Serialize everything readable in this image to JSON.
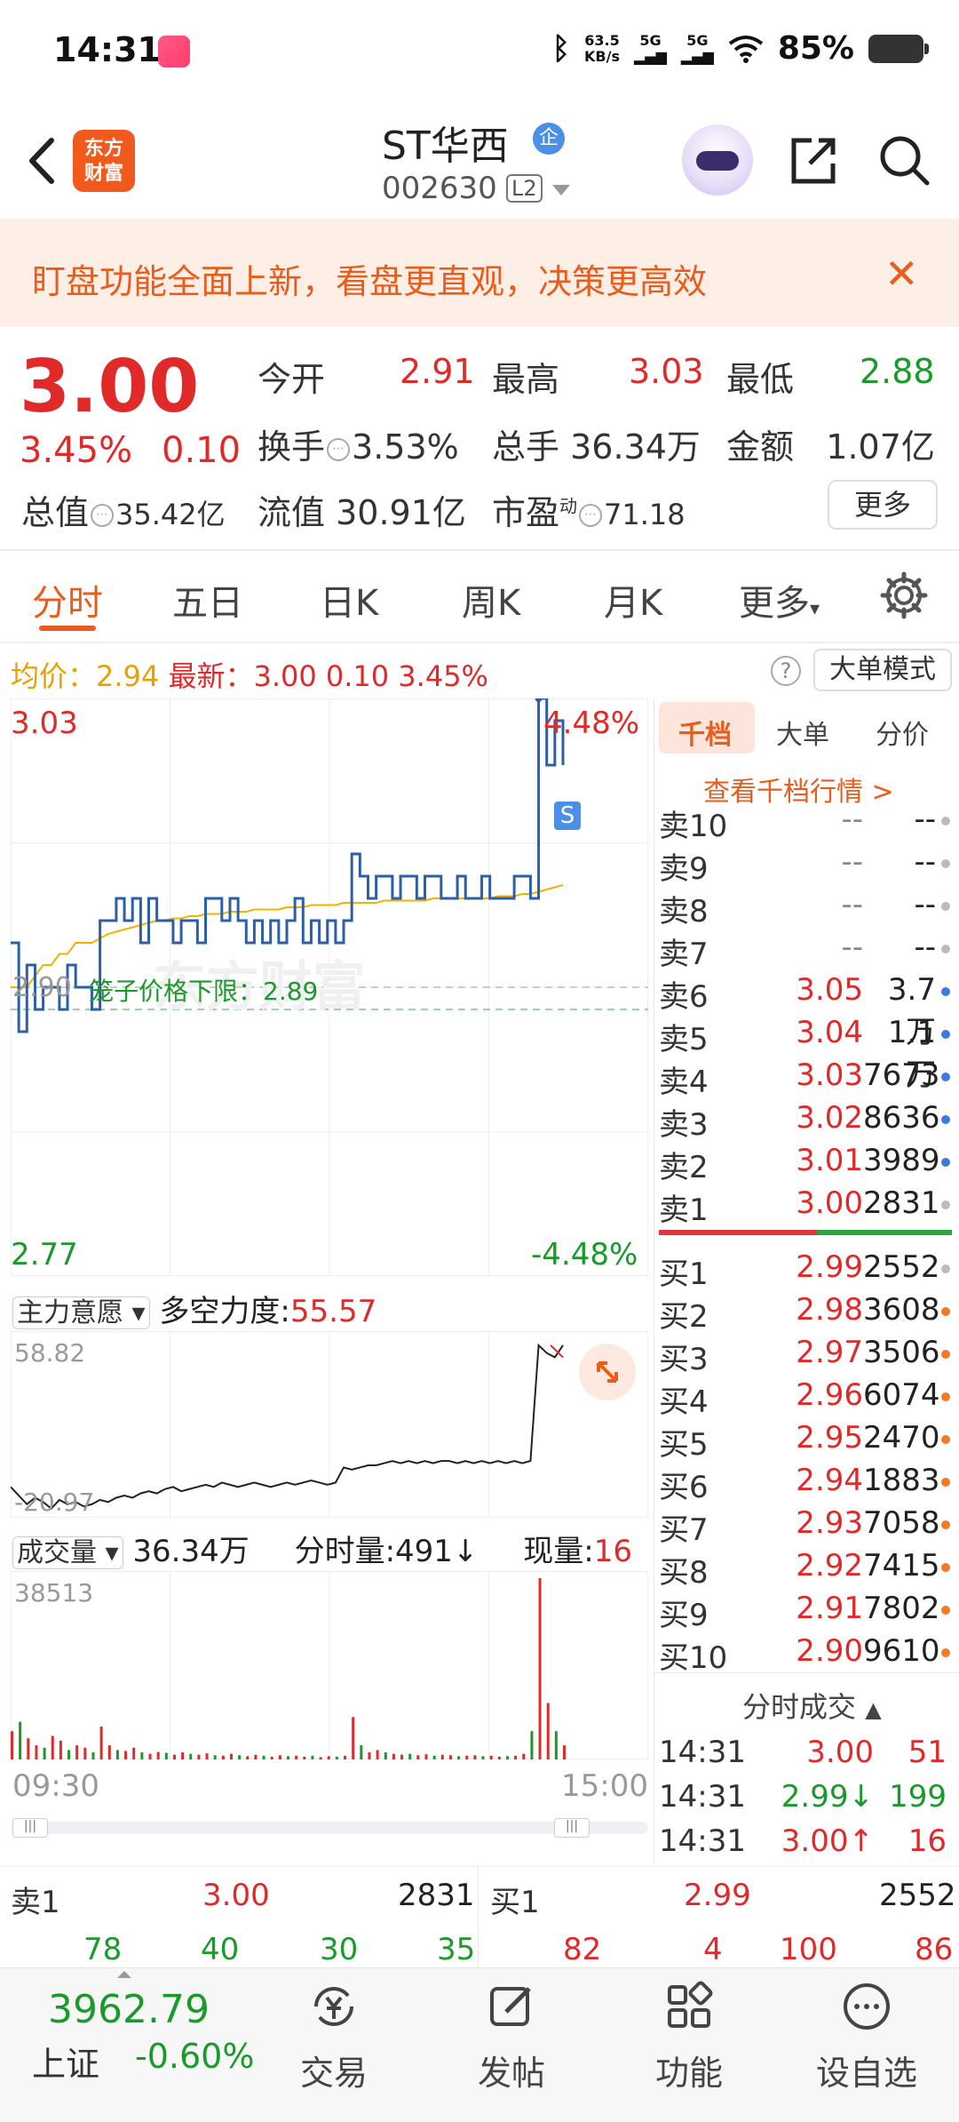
{
  "status_bar": {
    "time": "14:31",
    "net_speed_top": "63.5",
    "net_speed_bottom": "KB/s",
    "sig1": "5G",
    "sig2": "5G",
    "battery": "85%"
  },
  "header": {
    "stock_name": "ST华西",
    "badge": "企",
    "stock_code": "002630",
    "level": "L2",
    "logo_line1": "东方",
    "logo_line2": "财富"
  },
  "banner": {
    "text": "盯盘功能全面上新，看盘更直观，决策更高效",
    "close": "✕"
  },
  "quote": {
    "price": "3.00",
    "change_pct": "3.45%",
    "change": "0.10",
    "open_label": "今开",
    "open": "2.91",
    "high_label": "最高",
    "high": "3.03",
    "low_label": "最低",
    "low": "2.88",
    "turnover_label": "换手",
    "turnover": "3.53%",
    "volume_label": "总手",
    "volume": "36.34万",
    "amount_label": "金额",
    "amount": "1.07亿",
    "mcap_label": "总值",
    "mcap": "35.42亿",
    "float_label": "流值",
    "float": "30.91亿",
    "pe_label": "市盈",
    "pe_sup": "动",
    "pe": "71.18",
    "more": "更多"
  },
  "tabs": [
    "分时",
    "五日",
    "日K",
    "周K",
    "月K",
    "更多"
  ],
  "summary": {
    "avg_label": "均价：",
    "avg": "2.94",
    "last_label": "最新：",
    "last": "3.00",
    "chg": "0.10",
    "pct": "3.45%",
    "big_order_mode": "大单模式",
    "help": "?"
  },
  "chart": {
    "y_top": "3.03",
    "y_top_pct": "4.48%",
    "y_bottom": "2.77",
    "y_bottom_pct": "-4.48%",
    "y_mid": "2.90",
    "cage_label": "笼子价格下限：2.89",
    "s_marker": "S",
    "watermark": "东方财富",
    "ind_name": "主力意愿",
    "ind_label": "多空力度:",
    "ind_value": "55.57",
    "ind_max": "58.82",
    "ind_min": "-20.97",
    "vol_name": "成交量",
    "vol_total": "36.34万",
    "vol_min_label": "分时量:",
    "vol_min": "491",
    "vol_min_dir": "↓",
    "vol_now_label": "现量:",
    "vol_now": "16",
    "vol_max": "38513",
    "t_start": "09:30",
    "t_end": "15:00"
  },
  "chart_data": {
    "type": "line",
    "ylim": [
      2.77,
      3.03
    ],
    "price_line": [
      2.92,
      2.88,
      2.91,
      2.89,
      2.9,
      2.9,
      2.89,
      2.91,
      2.9,
      2.9,
      2.89,
      2.93,
      2.93,
      2.94,
      2.93,
      2.94,
      2.92,
      2.94,
      2.93,
      2.93,
      2.92,
      2.93,
      2.93,
      2.92,
      2.94,
      2.94,
      2.93,
      2.94,
      2.93,
      2.92,
      2.93,
      2.92,
      2.93,
      2.92,
      2.93,
      2.94,
      2.92,
      2.93,
      2.92,
      2.93,
      2.92,
      2.93,
      2.96,
      2.95,
      2.94,
      2.95,
      2.95,
      2.94,
      2.95,
      2.95,
      2.94,
      2.95,
      2.95,
      2.94,
      2.94,
      2.95,
      2.94,
      2.94,
      2.95,
      2.94,
      2.94,
      2.94,
      2.95,
      2.95,
      2.94,
      3.03,
      3.0,
      3.02,
      3.0
    ],
    "avg_line": [
      2.9,
      2.9,
      2.9,
      2.905,
      2.91,
      2.91,
      2.915,
      2.915,
      2.92,
      2.92,
      2.92,
      2.922,
      2.924,
      2.925,
      2.926,
      2.927,
      2.928,
      2.929,
      2.93,
      2.93,
      2.931,
      2.931,
      2.932,
      2.932,
      2.933,
      2.933,
      2.933,
      2.934,
      2.934,
      2.934,
      2.935,
      2.935,
      2.935,
      2.935,
      2.936,
      2.936,
      2.936,
      2.937,
      2.937,
      2.937,
      2.937,
      2.938,
      2.938,
      2.938,
      2.938,
      2.938,
      2.939,
      2.939,
      2.939,
      2.939,
      2.939,
      2.939,
      2.94,
      2.94,
      2.94,
      2.94,
      2.94,
      2.94,
      2.94,
      2.94,
      2.941,
      2.941,
      2.941,
      2.942,
      2.942,
      2.943,
      2.944,
      2.945,
      2.946
    ]
  },
  "indicator_data": {
    "ylim": [
      -20.97,
      58.82
    ],
    "values": [
      -10,
      -14,
      -18,
      -15,
      -17,
      -20,
      -16,
      -18,
      -17,
      -19,
      -18,
      -16,
      -17,
      -15,
      -14,
      -15,
      -13,
      -12,
      -13,
      -11,
      -10,
      -12,
      -11,
      -10,
      -9,
      -10,
      -8,
      -9,
      -10,
      -9,
      -8,
      -9,
      -10,
      -9,
      -8,
      -9,
      -8,
      -7,
      -8,
      -9,
      -8,
      -1,
      -2,
      -1,
      0,
      0,
      1,
      2,
      1,
      2,
      1,
      2,
      1,
      2,
      2,
      1,
      2,
      1,
      2,
      1,
      2,
      1,
      2,
      1,
      2,
      55.57,
      52,
      50,
      55.57
    ]
  },
  "volume_data": {
    "max": 38513,
    "bars": [
      6000,
      8000,
      4500,
      3000,
      2500,
      5000,
      4000,
      2000,
      3000,
      2500,
      1500,
      7000,
      3000,
      2000,
      1800,
      2500,
      1500,
      1200,
      1600,
      1400,
      1000,
      1500,
      1200,
      1000,
      1300,
      900,
      800,
      1200,
      900,
      700,
      1000,
      800,
      600,
      900,
      700,
      800,
      600,
      800,
      500,
      700,
      600,
      800,
      9000,
      3000,
      1500,
      2000,
      1500,
      1200,
      1000,
      1200,
      900,
      1100,
      800,
      1000,
      900,
      700,
      800,
      900,
      700,
      800,
      600,
      700,
      800,
      1200,
      6000,
      38513,
      12000,
      6000,
      3000
    ]
  },
  "order_book": {
    "tabs": [
      "千档",
      "大单",
      "分价"
    ],
    "link": "查看千档行情 >",
    "sells": [
      {
        "k": "卖10",
        "p": "--",
        "v": "--",
        "dot": "#bbbbbb"
      },
      {
        "k": "卖9",
        "p": "--",
        "v": "--",
        "dot": "#bbbbbb"
      },
      {
        "k": "卖8",
        "p": "--",
        "v": "--",
        "dot": "#bbbbbb"
      },
      {
        "k": "卖7",
        "p": "--",
        "v": "--",
        "dot": "#bbbbbb"
      },
      {
        "k": "卖6",
        "p": "3.05",
        "v": "3.7万",
        "dot": "#3b7bdc"
      },
      {
        "k": "卖5",
        "p": "3.04",
        "v": "1.1万",
        "dot": "#3b7bdc"
      },
      {
        "k": "卖4",
        "p": "3.03",
        "v": "7673",
        "dot": "#3b7bdc"
      },
      {
        "k": "卖3",
        "p": "3.02",
        "v": "8636",
        "dot": "#3b7bdc"
      },
      {
        "k": "卖2",
        "p": "3.01",
        "v": "3989",
        "dot": "#3b7bdc"
      },
      {
        "k": "卖1",
        "p": "3.00",
        "v": "2831",
        "dot": "#bbbbbb"
      }
    ],
    "buys": [
      {
        "k": "买1",
        "p": "2.99",
        "v": "2552",
        "dot": "#bbbbbb"
      },
      {
        "k": "买2",
        "p": "2.98",
        "v": "3608",
        "dot": "#f07a2a"
      },
      {
        "k": "买3",
        "p": "2.97",
        "v": "3506",
        "dot": "#f07a2a"
      },
      {
        "k": "买4",
        "p": "2.96",
        "v": "6074",
        "dot": "#f07a2a"
      },
      {
        "k": "买5",
        "p": "2.95",
        "v": "2470",
        "dot": "#f07a2a"
      },
      {
        "k": "买6",
        "p": "2.94",
        "v": "1883",
        "dot": "#f07a2a"
      },
      {
        "k": "买7",
        "p": "2.93",
        "v": "7058",
        "dot": "#f07a2a"
      },
      {
        "k": "买8",
        "p": "2.92",
        "v": "7415",
        "dot": "#f07a2a"
      },
      {
        "k": "买9",
        "p": "2.91",
        "v": "7802",
        "dot": "#f07a2a"
      },
      {
        "k": "买10",
        "p": "2.90",
        "v": "9610",
        "dot": "#f07a2a"
      }
    ],
    "ticks_title": "分时成交",
    "ticks": [
      {
        "t": "14:31",
        "p": "3.00",
        "v": "51",
        "pc": "#e02a2a",
        "vc": "#e02a2a"
      },
      {
        "t": "14:31",
        "p": "2.99↓",
        "v": "199",
        "pc": "#1a9a2a",
        "vc": "#1a9a2a"
      },
      {
        "t": "14:31",
        "p": "3.00↑",
        "v": "16",
        "pc": "#e02a2a",
        "vc": "#e02a2a"
      }
    ]
  },
  "bottom_strip": {
    "sell_label": "卖1",
    "sell_price": "3.00",
    "sell_vol": "2831",
    "buy_label": "买1",
    "buy_price": "2.99",
    "buy_vol": "2552",
    "sell_queue": [
      "78",
      "40",
      "30",
      "35"
    ],
    "buy_queue": [
      "82",
      "4",
      "100",
      "86"
    ]
  },
  "nav": {
    "index_value": "3962.79",
    "index_name": "上证",
    "index_pct": "-0.60%",
    "items": [
      "交易",
      "发帖",
      "功能",
      "设自选"
    ]
  },
  "colors": {
    "red": "#e02a2a",
    "green": "#1a9a2a",
    "orange": "#e85d1c",
    "blue_line": "#2b5fa8",
    "avg_line": "#f0b400"
  }
}
